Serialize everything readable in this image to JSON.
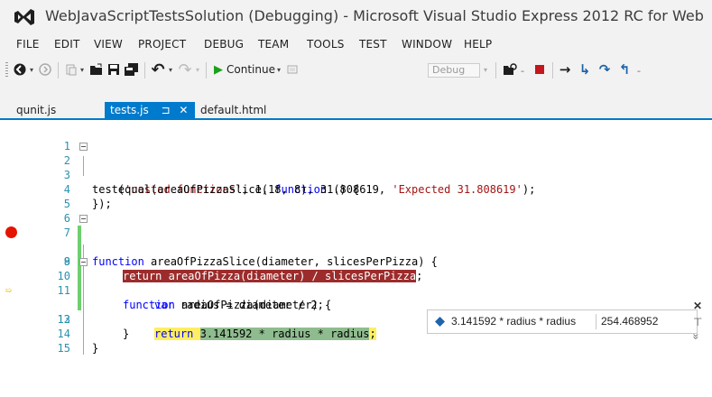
{
  "window": {
    "title": "WebJavaScriptTestsSolution (Debugging) - Microsoft Visual Studio Express 2012 RC for Web"
  },
  "menu": [
    "FILE",
    "EDIT",
    "VIEW",
    "PROJECT",
    "DEBUG",
    "TEAM",
    "TOOLS",
    "TEST",
    "WINDOW",
    "HELP"
  ],
  "toolbar": {
    "continue_label": "Continue",
    "config_value": "Debug"
  },
  "tabs": [
    {
      "label": "qunit.js",
      "active": false
    },
    {
      "label": "tests.js",
      "active": true,
      "pin": "⊐",
      "close": "✕"
    },
    {
      "label": "default.html",
      "active": false
    }
  ],
  "editor": {
    "lines": [
      {
        "num": "1"
      },
      {
        "num": "2"
      },
      {
        "num": "3"
      },
      {
        "num": "4"
      },
      {
        "num": "5"
      },
      {
        "num": "6"
      },
      {
        "num": "7"
      },
      {
        "num": "8"
      },
      {
        "num": "9"
      },
      {
        "num": "10"
      },
      {
        "num": "11"
      },
      {
        "num": "12"
      },
      {
        "num": "13"
      },
      {
        "num": "14"
      },
      {
        "num": "15"
      }
    ],
    "code": {
      "l2_kw": "test(",
      "l2_str": "'nested functions'",
      "l2_rest": ", 1, ",
      "l2_kw2": "function",
      "l2_end": " () {",
      "l3_a": "    equal(areaOfPizzaSlice(18, 8), 31.808619, ",
      "l3_str": "'Expected 31.808619'",
      "l3_end": ");",
      "l4": "});",
      "l7_kw": "function",
      "l7_rest": " areaOfPizzaSlice(diameter, slicesPerPizza) {",
      "l8_hl": "return areaOfPizza(diameter) / slicesPerPizza",
      "l8_end": ";",
      "l10_kw": "function",
      "l10_rest": " areaOfPizza(diameter) {",
      "l11_kw": "var",
      "l11_rest": " radius = diameter / 2;",
      "l12_kw": "return",
      "l12_sel": "3.141592 * radius * radius",
      "l12_end": ";",
      "l13": "}",
      "l14": "}"
    }
  },
  "datatip": {
    "expression": "3.141592 * radius * radius",
    "value": "254.468952"
  },
  "datatip_side": {
    "close": "✕",
    "pin": "⊤",
    "expand": "»"
  },
  "colors": {
    "accent": "#007acc",
    "breakpoint": "#e51400",
    "breakpoint_line": "#9c2c2c",
    "current_statement": "#ffee62"
  }
}
